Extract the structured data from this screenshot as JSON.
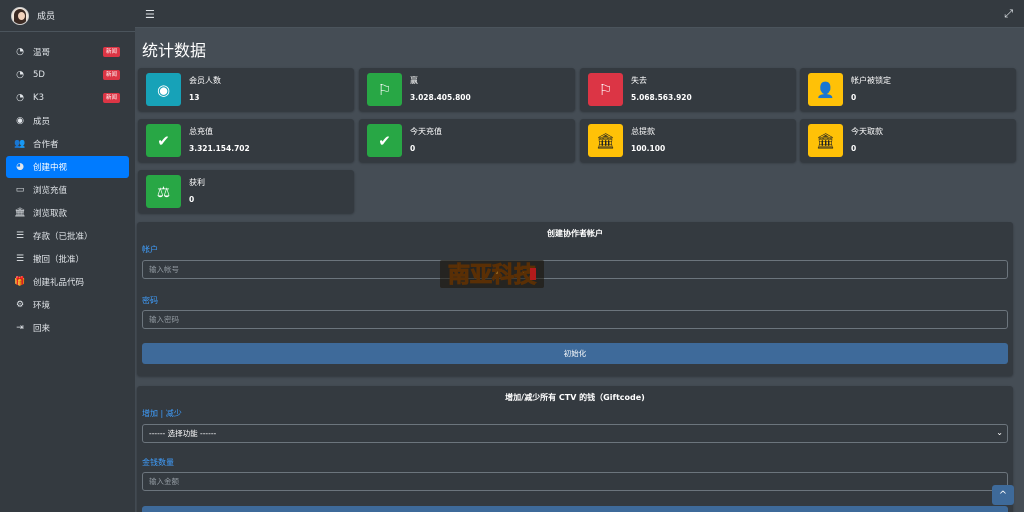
{
  "brand": {
    "label": "成员"
  },
  "sidebar": {
    "items": [
      {
        "label": "温哥",
        "icon": "gauge-icon",
        "badge": "新闻"
      },
      {
        "label": "5D",
        "icon": "gauge-icon",
        "badge": "新闻"
      },
      {
        "label": "K3",
        "icon": "gauge-icon",
        "badge": "新闻"
      },
      {
        "label": "成员",
        "icon": "user-circle-icon"
      },
      {
        "label": "合作者",
        "icon": "users-icon"
      },
      {
        "label": "创建中视",
        "icon": "pie-chart-icon",
        "active": true
      },
      {
        "label": "浏览充值",
        "icon": "credit-card-icon"
      },
      {
        "label": "浏览取款",
        "icon": "bank-icon"
      },
      {
        "label": "存款（已批准）",
        "icon": "list-icon"
      },
      {
        "label": "撤回（批准）",
        "icon": "list-icon"
      },
      {
        "label": "创建礼品代码",
        "icon": "gift-icon"
      },
      {
        "label": "环境",
        "icon": "gear-icon"
      },
      {
        "label": "回来",
        "icon": "sign-out-icon"
      }
    ]
  },
  "page": {
    "title": "统计数据"
  },
  "stats": [
    {
      "label": "会员人数",
      "value": "13",
      "icon": "user-circle-icon",
      "color": "#17a2b8"
    },
    {
      "label": "赢",
      "value": "3.028.405.800",
      "icon": "flag-icon",
      "color": "#28a745"
    },
    {
      "label": "失去",
      "value": "5.068.563.920",
      "icon": "flag-icon",
      "color": "#dc3545"
    },
    {
      "label": "帐户被锁定",
      "value": "0",
      "icon": "user-lock-icon",
      "color": "#ffc107"
    },
    {
      "label": "总充值",
      "value": "3.321.154.702",
      "icon": "check-icon",
      "color": "#28a745"
    },
    {
      "label": "今天充值",
      "value": "0",
      "icon": "check-icon",
      "color": "#28a745"
    },
    {
      "label": "总提款",
      "value": "100.100",
      "icon": "bank-icon",
      "color": "#ffc107"
    },
    {
      "label": "今天取款",
      "value": "0",
      "icon": "bank-icon",
      "color": "#ffc107"
    },
    {
      "label": "获利",
      "value": "0",
      "icon": "balance-scale-icon",
      "color": "#28a745"
    }
  ],
  "create_collaborator": {
    "title": "创建协作者帐户",
    "account_label": "帐户",
    "account_placeholder": "输入帐号",
    "password_label": "密码",
    "password_placeholder": "输入密码",
    "submit_label": "初始化"
  },
  "giftcode": {
    "title": "增加/减少所有 CTV 的钱（Giftcode)",
    "mode_label": "增加 | 减少",
    "mode_selected": "------ 选择功能 ------",
    "amount_label": "金钱数量",
    "amount_placeholder": "输入金额"
  },
  "logo": {
    "text": "南亚科技"
  }
}
